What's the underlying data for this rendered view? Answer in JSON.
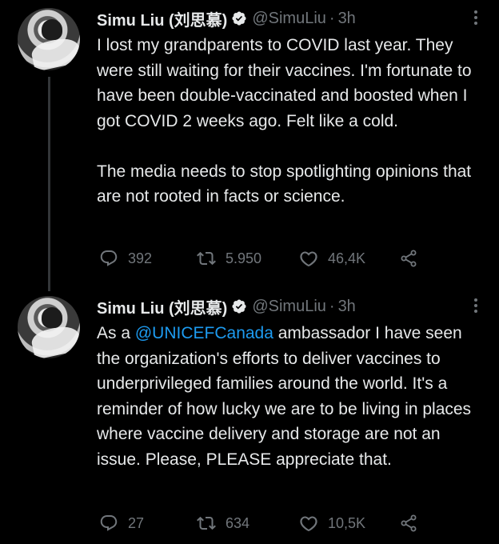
{
  "tweets": [
    {
      "name": "Simu Liu (刘思慕)",
      "handle": "@SimuLiu",
      "separator": "·",
      "time": "3h",
      "paragraphs": [
        "I lost my grandparents to COVID last year. They were still waiting for their vaccines. I'm fortunate to have been double-vaccinated and boosted when I got COVID 2 weeks ago. Felt like a cold.",
        "The media needs to stop spotlighting opinions that are not rooted in facts or science."
      ],
      "replies": "392",
      "retweets": "5.950",
      "likes": "46,4K"
    },
    {
      "name": "Simu Liu (刘思慕)",
      "handle": "@SimuLiu",
      "separator": "·",
      "time": "3h",
      "text_before_mention": "As a ",
      "mention": "@UNICEFCanada",
      "text_after_mention": " ambassador I have seen the organization's efforts to deliver vaccines to underprivileged families around the world. It's a reminder of how lucky we are to be living in places where vaccine delivery and storage are not an issue. Please, PLEASE appreciate that.",
      "replies": "27",
      "retweets": "634",
      "likes": "10,5K"
    }
  ],
  "icons": {
    "verified": "verified-badge-icon",
    "more": "more-icon",
    "reply": "reply-icon",
    "retweet": "retweet-icon",
    "like": "like-icon",
    "share": "share-icon"
  },
  "colors": {
    "background": "#000000",
    "text": "#e7e9ea",
    "muted": "#71767b",
    "link": "#1d9bf0",
    "thread_line": "#333639"
  }
}
